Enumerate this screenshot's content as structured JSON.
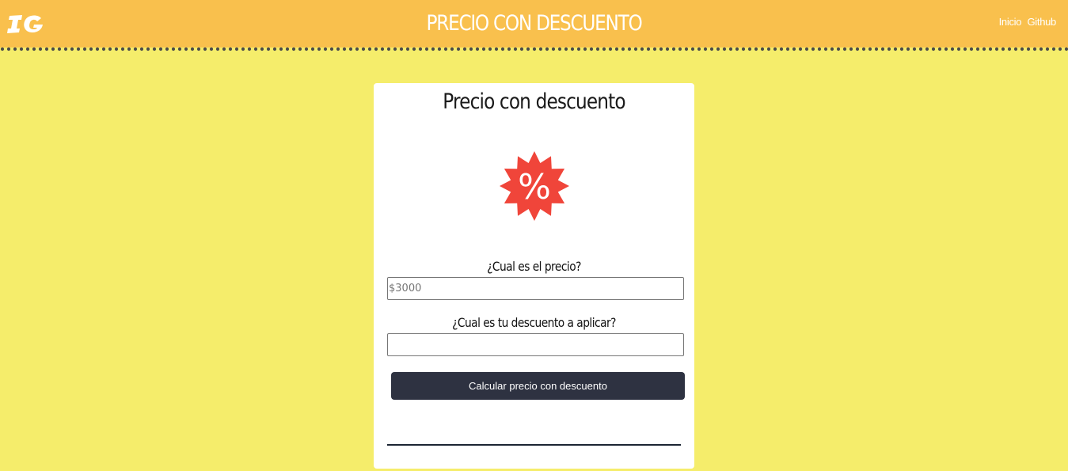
{
  "header": {
    "logo_text": "IG",
    "title": "PRECIO CON DESCUENTO",
    "nav": [
      {
        "label": "Inicio"
      },
      {
        "label": "Github"
      }
    ]
  },
  "card": {
    "title": "Precio con descuento",
    "badge_symbol": "%",
    "price_label": "¿Cual es el precio?",
    "price_placeholder": "$3000",
    "price_value": "",
    "discount_label": "¿Cual es tu descuento a aplicar?",
    "discount_placeholder": "",
    "discount_value": "",
    "button_label": "Calcular precio con descuento",
    "result": ""
  },
  "colors": {
    "background": "#f5ed6b",
    "header": "#f9c04d",
    "badge": "#f0453a",
    "button": "#2e3241",
    "dots": "#4a4a4a"
  }
}
